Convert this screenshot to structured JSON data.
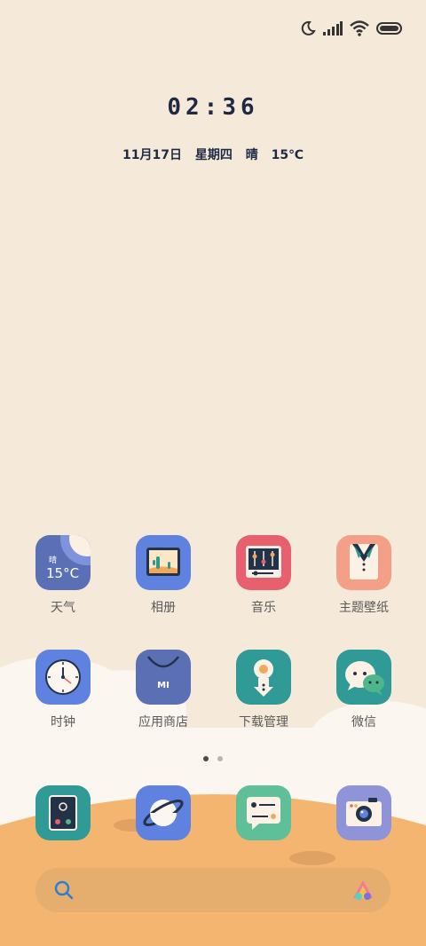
{
  "status_bar": {
    "icons": [
      "moon-icon",
      "signal-icon",
      "wifi-icon",
      "battery-icon"
    ]
  },
  "lockscreen": {
    "time": "02:36",
    "date": "11月17日",
    "weekday": "星期四",
    "weather": "晴",
    "temperature": "15℃"
  },
  "weather_widget": {
    "condition": "晴",
    "temp": "15°C"
  },
  "apps": [
    {
      "label": "天气",
      "icon": "weather-icon"
    },
    {
      "label": "相册",
      "icon": "gallery-icon"
    },
    {
      "label": "音乐",
      "icon": "music-icon"
    },
    {
      "label": "主题壁纸",
      "icon": "themes-icon"
    },
    {
      "label": "时钟",
      "icon": "clock-icon"
    },
    {
      "label": "应用商店",
      "icon": "app-store-icon"
    },
    {
      "label": "下载管理",
      "icon": "download-icon"
    },
    {
      "label": "微信",
      "icon": "wechat-icon"
    }
  ],
  "dock": [
    {
      "icon": "phone-icon"
    },
    {
      "icon": "browser-icon"
    },
    {
      "icon": "messages-icon"
    },
    {
      "icon": "camera-icon"
    }
  ],
  "page_indicator": {
    "pages": 2,
    "active": 1
  },
  "store_logo_text": "MI",
  "colors": {
    "background": "#f5ead9",
    "ground": "#f3b570",
    "search_bar": "#e5ae6e"
  }
}
